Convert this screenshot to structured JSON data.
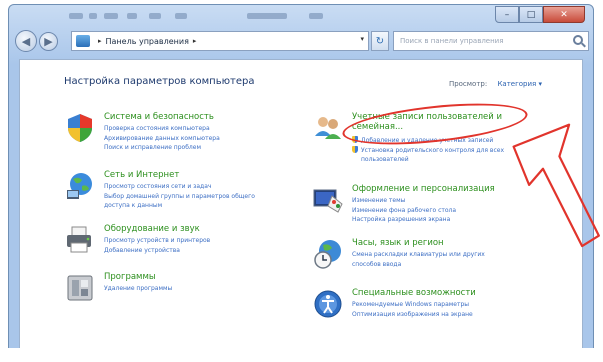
{
  "window": {
    "controls": {
      "minimize": "–",
      "maximize": "□",
      "close": "✕"
    }
  },
  "navbar": {
    "back_icon": "◀",
    "forward_icon": "▶",
    "breadcrumb": "Панель управления",
    "breadcrumb_sep": "▸",
    "dropdown_icon": "▾",
    "refresh_icon": "↻",
    "search_placeholder": "Поиск в панели управления"
  },
  "header": {
    "title": "Настройка параметров компьютера",
    "view_label": "Просмотр:",
    "view_value": "Категория ▾"
  },
  "categories": [
    {
      "title": "Система и безопасность",
      "icon": "shield-icon",
      "links": [
        "Проверка состояния компьютера",
        "Архивирование данных компьютера",
        "Поиск и исправление проблем"
      ]
    },
    {
      "title": "Сеть и Интернет",
      "icon": "network-globe-icon",
      "links": [
        "Просмотр состояния сети и задач",
        "Выбор домашней группы и параметров общего",
        "доступа к данным"
      ]
    },
    {
      "title": "Оборудование и звук",
      "icon": "printer-icon",
      "links": [
        "Просмотр устройств и принтеров",
        "Добавление устройства"
      ]
    },
    {
      "title": "Программы",
      "icon": "programs-icon",
      "links": [
        "Удаление программы"
      ]
    },
    {
      "title": "Учетные записи пользователей и",
      "title2": "семейная...",
      "icon": "users-icon",
      "links": [
        "Добавление и удаление учетных записей",
        "Установка родительского контроля для всех",
        "пользователей"
      ]
    },
    {
      "title": "Оформление и персонализация",
      "icon": "appearance-icon",
      "links": [
        "Изменение темы",
        "Изменение фона рабочего стола",
        "Настройка разрешения экрана"
      ]
    },
    {
      "title": "Часы, язык и регион",
      "icon": "clock-globe-icon",
      "links": [
        "Смена раскладки клавиатуры или других",
        "способов ввода"
      ]
    },
    {
      "title": "Специальные возможности",
      "icon": "ease-of-access-icon",
      "links": [
        "Рекомендуемые Windows параметры",
        "Оптимизация изображения на экране"
      ]
    }
  ],
  "colors": {
    "category_title": "#2c8f1d",
    "link": "#3d6fc4",
    "annotation": "#e1342c"
  }
}
